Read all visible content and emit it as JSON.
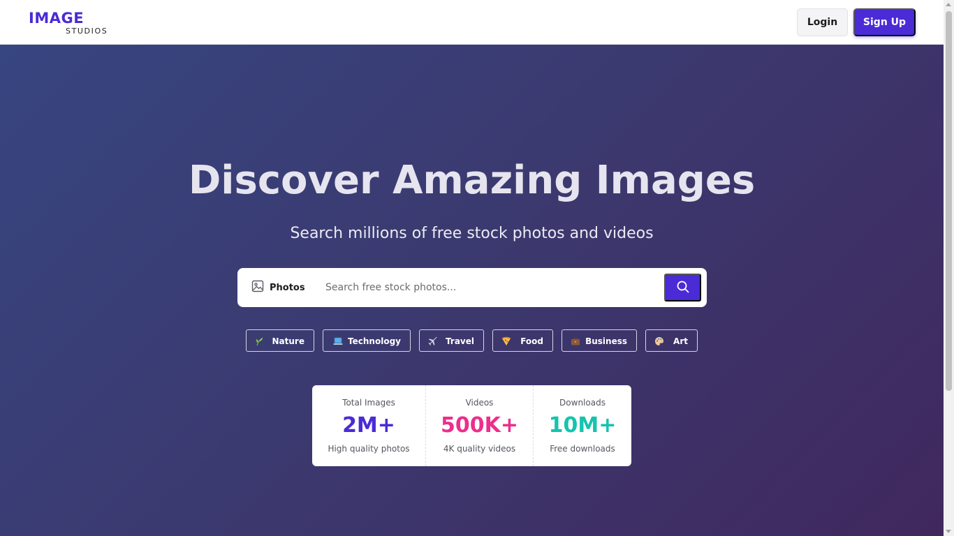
{
  "brand": {
    "name": "IMAGE",
    "tagline": "STUDIOS",
    "accent_color": "#4a2bd6"
  },
  "nav": {
    "login_label": "Login",
    "signup_label": "Sign Up"
  },
  "hero": {
    "title": "Discover Amazing Images",
    "subtitle": "Search millions of free stock photos and videos"
  },
  "search": {
    "type_label": "Photos",
    "type_icon": "image-icon",
    "placeholder": "Search free stock photos...",
    "value": "",
    "button_icon": "search-icon"
  },
  "categories": [
    {
      "label": "Nature",
      "icon": "herb-icon"
    },
    {
      "label": "Technology",
      "icon": "laptop-icon"
    },
    {
      "label": "Travel",
      "icon": "airplane-icon"
    },
    {
      "label": "Food",
      "icon": "pizza-icon"
    },
    {
      "label": "Business",
      "icon": "briefcase-icon"
    },
    {
      "label": "Art",
      "icon": "palette-icon"
    }
  ],
  "stats": [
    {
      "label": "Total Images",
      "value": "2M+",
      "desc": "High quality photos",
      "color": "#4a2bd6"
    },
    {
      "label": "Videos",
      "value": "500K+",
      "desc": "4K quality videos",
      "color": "#ec2e8c"
    },
    {
      "label": "Downloads",
      "value": "10M+",
      "desc": "Free downloads",
      "color": "#14c4ae"
    }
  ]
}
